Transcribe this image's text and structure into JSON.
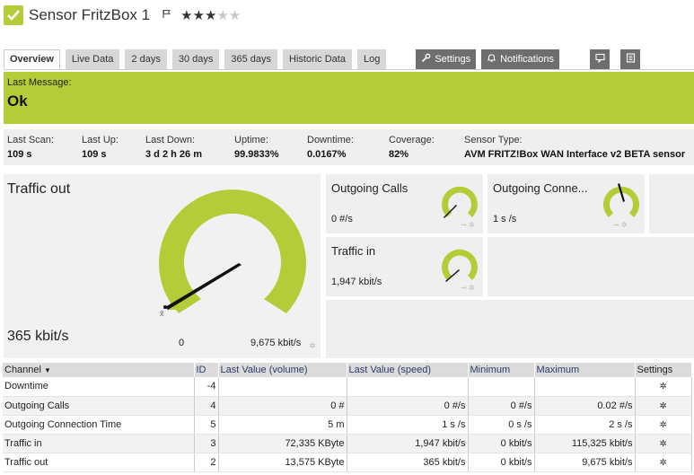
{
  "header": {
    "title": "Sensor FritzBox 1",
    "flag_icon": "flag-icon",
    "stars": 3,
    "stars_max": 5
  },
  "tabs": [
    {
      "label": "Overview",
      "active": true
    },
    {
      "label": "Live Data"
    },
    {
      "label": "2 days"
    },
    {
      "label": "30 days"
    },
    {
      "label": "365 days"
    },
    {
      "label": "Historic Data"
    },
    {
      "label": "Log"
    }
  ],
  "actions": {
    "settings": "Settings",
    "notifications": "Notifications"
  },
  "banner": {
    "label": "Last Message:",
    "message": "Ok",
    "color": "#b4cc38"
  },
  "info": {
    "last_scan": {
      "k": "Last Scan:",
      "v": "109 s"
    },
    "last_up": {
      "k": "Last Up:",
      "v": "109 s"
    },
    "last_down": {
      "k": "Last Down:",
      "v": "3 d 2 h 26 m"
    },
    "uptime": {
      "k": "Uptime:",
      "v": "99.9833%"
    },
    "downtime": {
      "k": "Downtime:",
      "v": "0.0167%"
    },
    "coverage": {
      "k": "Coverage:",
      "v": "82%"
    },
    "sensor_type": {
      "k": "Sensor Type:",
      "v": "AVM FRITZ!Box WAN Interface v2 BETA sensor"
    }
  },
  "gauges": {
    "traffic_out": {
      "name": "Traffic out",
      "value": "365 kbit/s",
      "min": "0",
      "max": "9,675 kbit/s",
      "min_marker": "x̄"
    },
    "outgoing_calls": {
      "name": "Outgoing Calls",
      "value": "0 #/s"
    },
    "outgoing_conn": {
      "name": "Outgoing Conne...",
      "value": "1 s /s"
    },
    "traffic_in": {
      "name": "Traffic in",
      "value": "1,947 kbit/s"
    }
  },
  "table": {
    "headers": {
      "channel": "Channel",
      "id": "ID",
      "last_volume": "Last Value (volume)",
      "last_speed": "Last Value (speed)",
      "minimum": "Minimum",
      "maximum": "Maximum",
      "settings": "Settings"
    },
    "rows": [
      {
        "channel": "Downtime",
        "id": "-4",
        "volume": "",
        "speed": "",
        "min": "",
        "max": ""
      },
      {
        "channel": "Outgoing Calls",
        "id": "4",
        "volume": "0 #",
        "speed": "0 #/s",
        "min": "0 #/s",
        "max": "0.02 #/s"
      },
      {
        "channel": "Outgoing Connection Time",
        "id": "5",
        "volume": "5 m",
        "speed": "1 s /s",
        "min": "0 s /s",
        "max": "2 s /s"
      },
      {
        "channel": "Traffic in",
        "id": "3",
        "volume": "72,335 KByte",
        "speed": "1,947 kbit/s",
        "min": "0 kbit/s",
        "max": "115,325 kbit/s"
      },
      {
        "channel": "Traffic out",
        "id": "2",
        "volume": "13,575 KByte",
        "speed": "365 kbit/s",
        "min": "0 kbit/s",
        "max": "9,675 kbit/s"
      }
    ]
  }
}
